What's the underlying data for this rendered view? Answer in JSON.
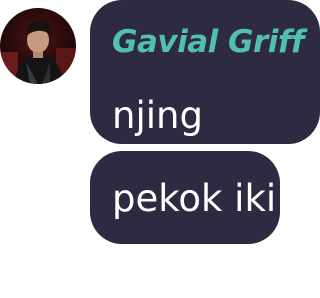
{
  "messages": [
    {
      "sender": "Gavial Griff",
      "text": "njing"
    },
    {
      "text": "pekok iki"
    }
  ],
  "colors": {
    "bubble_bg": "#2e2a42",
    "sender_name": "#52c1aa",
    "message_text": "#ffffff"
  },
  "icons": {
    "avatar": "user-avatar-photo"
  }
}
